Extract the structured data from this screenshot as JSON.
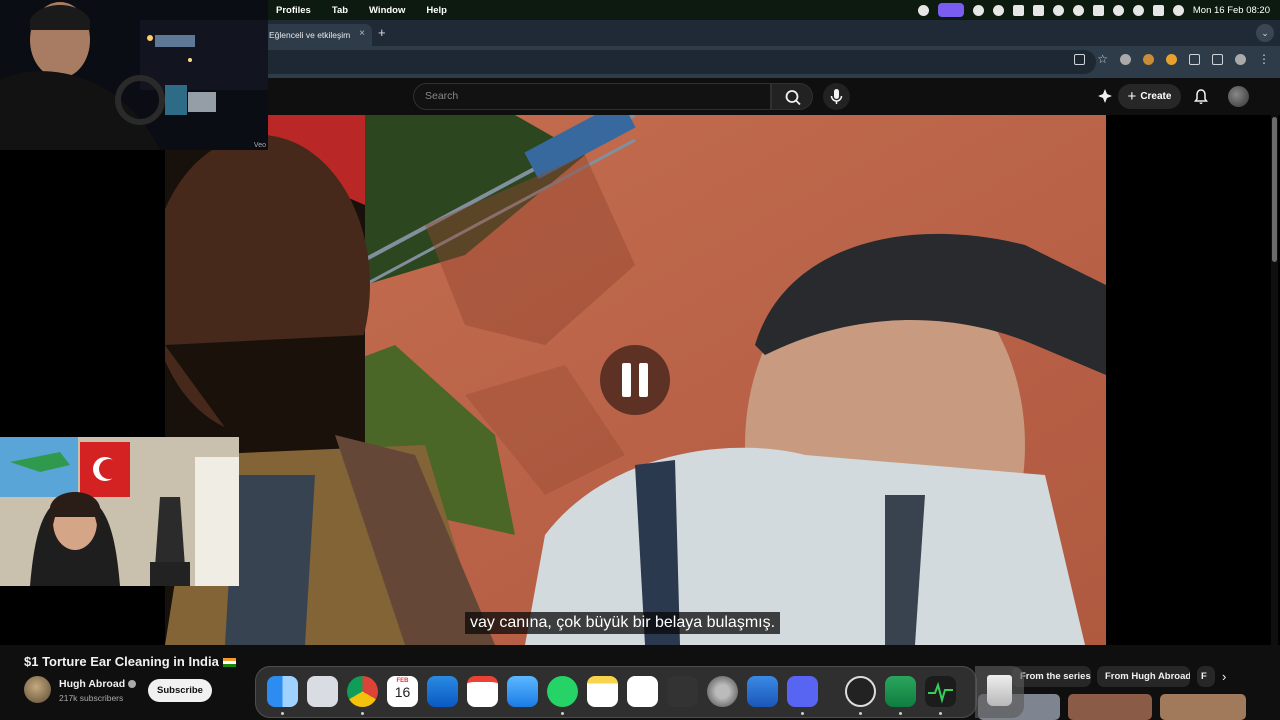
{
  "menubar": {
    "items": [
      "Profiles",
      "Tab",
      "Window",
      "Help"
    ],
    "clock": "Mon 16 Feb  08:20"
  },
  "browser": {
    "tab_title": "Eğlenceli ve etkileşim",
    "tab_close": "×",
    "new_tab": "+"
  },
  "youtube": {
    "search_placeholder": "Search",
    "create_label": "Create"
  },
  "video": {
    "subtitle": "vay canına, çok büyük bir belaya bulaşmış."
  },
  "webcam_top": {
    "label": "Veo"
  },
  "video_info": {
    "title": "$1 Torture Ear Cleaning in India",
    "channel_name": "Hugh Abroad",
    "subscribers": "217k subscribers",
    "subscribe_label": "Subscribe"
  },
  "chips": [
    "From the series",
    "From Hugh Abroad",
    "F"
  ],
  "dock": {
    "calendar_month": "FEB",
    "calendar_day": "16"
  },
  "colors": {
    "youtube_bg": "#0f0f0f",
    "wall": "#c86a4e",
    "menubar": "#0c1a10"
  }
}
